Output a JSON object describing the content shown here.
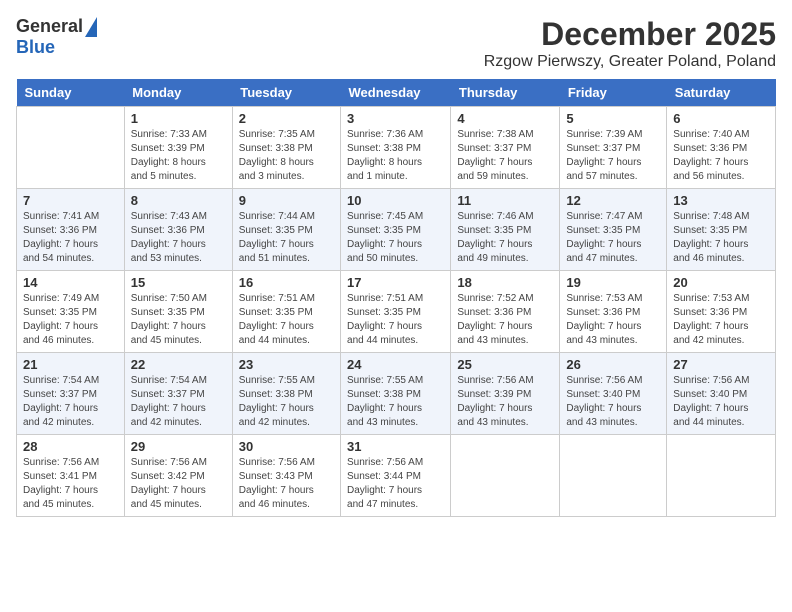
{
  "logo": {
    "general": "General",
    "blue": "Blue"
  },
  "title": "December 2025",
  "subtitle": "Rzgow Pierwszy, Greater Poland, Poland",
  "columns": [
    "Sunday",
    "Monday",
    "Tuesday",
    "Wednesday",
    "Thursday",
    "Friday",
    "Saturday"
  ],
  "weeks": [
    [
      {
        "day": "",
        "info": ""
      },
      {
        "day": "1",
        "info": "Sunrise: 7:33 AM\nSunset: 3:39 PM\nDaylight: 8 hours\nand 5 minutes."
      },
      {
        "day": "2",
        "info": "Sunrise: 7:35 AM\nSunset: 3:38 PM\nDaylight: 8 hours\nand 3 minutes."
      },
      {
        "day": "3",
        "info": "Sunrise: 7:36 AM\nSunset: 3:38 PM\nDaylight: 8 hours\nand 1 minute."
      },
      {
        "day": "4",
        "info": "Sunrise: 7:38 AM\nSunset: 3:37 PM\nDaylight: 7 hours\nand 59 minutes."
      },
      {
        "day": "5",
        "info": "Sunrise: 7:39 AM\nSunset: 3:37 PM\nDaylight: 7 hours\nand 57 minutes."
      },
      {
        "day": "6",
        "info": "Sunrise: 7:40 AM\nSunset: 3:36 PM\nDaylight: 7 hours\nand 56 minutes."
      }
    ],
    [
      {
        "day": "7",
        "info": "Sunrise: 7:41 AM\nSunset: 3:36 PM\nDaylight: 7 hours\nand 54 minutes."
      },
      {
        "day": "8",
        "info": "Sunrise: 7:43 AM\nSunset: 3:36 PM\nDaylight: 7 hours\nand 53 minutes."
      },
      {
        "day": "9",
        "info": "Sunrise: 7:44 AM\nSunset: 3:35 PM\nDaylight: 7 hours\nand 51 minutes."
      },
      {
        "day": "10",
        "info": "Sunrise: 7:45 AM\nSunset: 3:35 PM\nDaylight: 7 hours\nand 50 minutes."
      },
      {
        "day": "11",
        "info": "Sunrise: 7:46 AM\nSunset: 3:35 PM\nDaylight: 7 hours\nand 49 minutes."
      },
      {
        "day": "12",
        "info": "Sunrise: 7:47 AM\nSunset: 3:35 PM\nDaylight: 7 hours\nand 47 minutes."
      },
      {
        "day": "13",
        "info": "Sunrise: 7:48 AM\nSunset: 3:35 PM\nDaylight: 7 hours\nand 46 minutes."
      }
    ],
    [
      {
        "day": "14",
        "info": "Sunrise: 7:49 AM\nSunset: 3:35 PM\nDaylight: 7 hours\nand 46 minutes."
      },
      {
        "day": "15",
        "info": "Sunrise: 7:50 AM\nSunset: 3:35 PM\nDaylight: 7 hours\nand 45 minutes."
      },
      {
        "day": "16",
        "info": "Sunrise: 7:51 AM\nSunset: 3:35 PM\nDaylight: 7 hours\nand 44 minutes."
      },
      {
        "day": "17",
        "info": "Sunrise: 7:51 AM\nSunset: 3:35 PM\nDaylight: 7 hours\nand 44 minutes."
      },
      {
        "day": "18",
        "info": "Sunrise: 7:52 AM\nSunset: 3:36 PM\nDaylight: 7 hours\nand 43 minutes."
      },
      {
        "day": "19",
        "info": "Sunrise: 7:53 AM\nSunset: 3:36 PM\nDaylight: 7 hours\nand 43 minutes."
      },
      {
        "day": "20",
        "info": "Sunrise: 7:53 AM\nSunset: 3:36 PM\nDaylight: 7 hours\nand 42 minutes."
      }
    ],
    [
      {
        "day": "21",
        "info": "Sunrise: 7:54 AM\nSunset: 3:37 PM\nDaylight: 7 hours\nand 42 minutes."
      },
      {
        "day": "22",
        "info": "Sunrise: 7:54 AM\nSunset: 3:37 PM\nDaylight: 7 hours\nand 42 minutes."
      },
      {
        "day": "23",
        "info": "Sunrise: 7:55 AM\nSunset: 3:38 PM\nDaylight: 7 hours\nand 42 minutes."
      },
      {
        "day": "24",
        "info": "Sunrise: 7:55 AM\nSunset: 3:38 PM\nDaylight: 7 hours\nand 43 minutes."
      },
      {
        "day": "25",
        "info": "Sunrise: 7:56 AM\nSunset: 3:39 PM\nDaylight: 7 hours\nand 43 minutes."
      },
      {
        "day": "26",
        "info": "Sunrise: 7:56 AM\nSunset: 3:40 PM\nDaylight: 7 hours\nand 43 minutes."
      },
      {
        "day": "27",
        "info": "Sunrise: 7:56 AM\nSunset: 3:40 PM\nDaylight: 7 hours\nand 44 minutes."
      }
    ],
    [
      {
        "day": "28",
        "info": "Sunrise: 7:56 AM\nSunset: 3:41 PM\nDaylight: 7 hours\nand 45 minutes."
      },
      {
        "day": "29",
        "info": "Sunrise: 7:56 AM\nSunset: 3:42 PM\nDaylight: 7 hours\nand 45 minutes."
      },
      {
        "day": "30",
        "info": "Sunrise: 7:56 AM\nSunset: 3:43 PM\nDaylight: 7 hours\nand 46 minutes."
      },
      {
        "day": "31",
        "info": "Sunrise: 7:56 AM\nSunset: 3:44 PM\nDaylight: 7 hours\nand 47 minutes."
      },
      {
        "day": "",
        "info": ""
      },
      {
        "day": "",
        "info": ""
      },
      {
        "day": "",
        "info": ""
      }
    ]
  ]
}
